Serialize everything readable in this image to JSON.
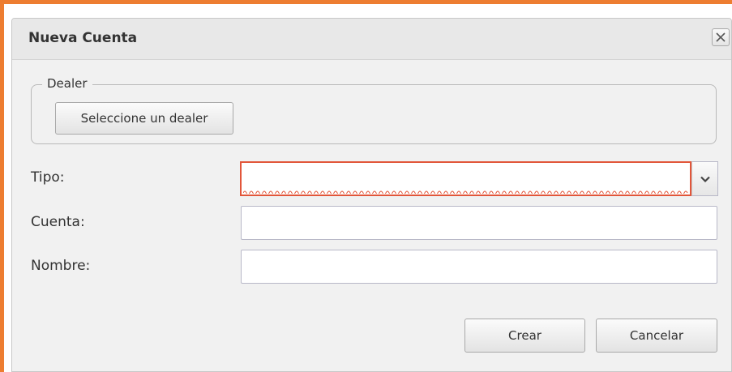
{
  "dialog": {
    "title": "Nueva Cuenta",
    "close_label": "close"
  },
  "dealer_group": {
    "legend": "Dealer",
    "button_label": "Seleccione un dealer"
  },
  "form": {
    "tipo_label": "Tipo:",
    "tipo_value": "",
    "cuenta_label": "Cuenta:",
    "cuenta_value": "",
    "nombre_label": "Nombre:",
    "nombre_value": ""
  },
  "actions": {
    "create_label": "Crear",
    "cancel_label": "Cancelar"
  },
  "colors": {
    "highlight_border": "#ed7d31",
    "invalid_border": "#e2563a"
  },
  "icons": {
    "close": "close-icon",
    "dropdown": "chevron-down-icon"
  }
}
